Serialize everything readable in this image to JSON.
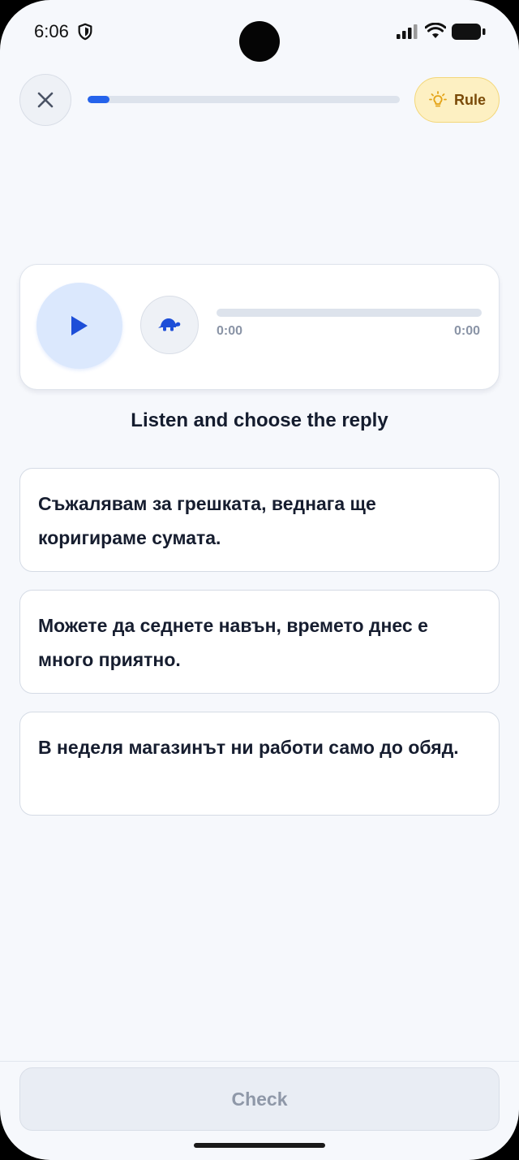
{
  "status_bar": {
    "time": "6:06"
  },
  "header": {
    "progress_fraction": 0.07,
    "rule_label": "Rule"
  },
  "audio": {
    "current_time": "0:00",
    "total_time": "0:00"
  },
  "instruction": "Listen and choose the reply",
  "options": [
    {
      "text": "Съжалявам за грешката, веднага ще коригираме сумата."
    },
    {
      "text": "Можете да седнете навън, времето днес е много приятно."
    },
    {
      "text": "В неделя магазинът ни работи само до обяд."
    }
  ],
  "footer": {
    "check_label": "Check"
  },
  "colors": {
    "accent": "#2563eb",
    "rule_bg": "#fdf0c2",
    "rule_text": "#7a4a08",
    "background": "#f6f8fc"
  }
}
